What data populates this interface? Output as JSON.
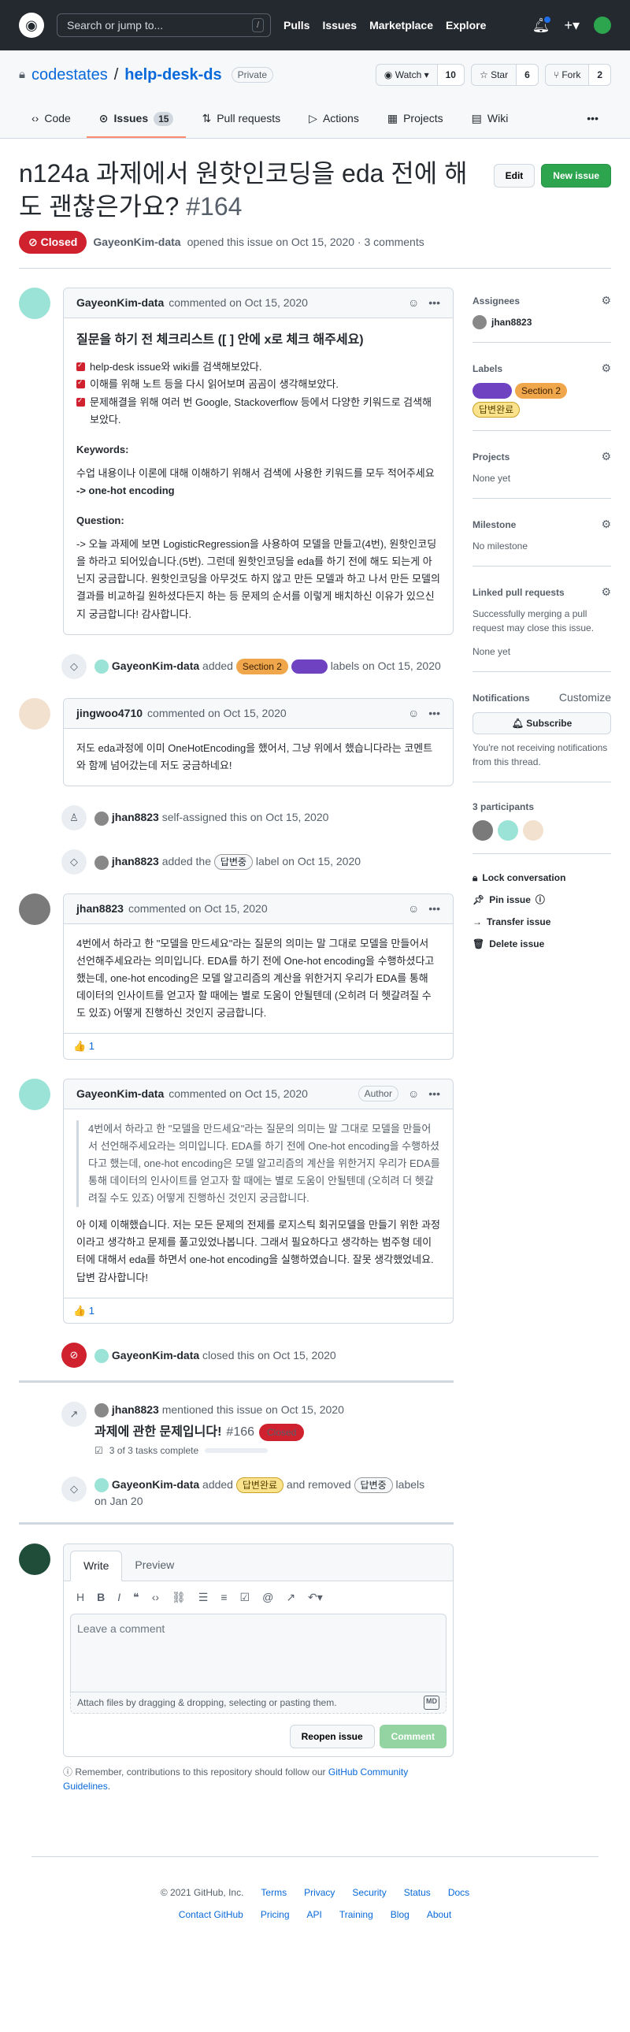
{
  "header": {
    "search_placeholder": "Search or jump to...",
    "search_key": "/",
    "nav": [
      "Pulls",
      "Issues",
      "Marketplace",
      "Explore"
    ]
  },
  "repo": {
    "owner": "codestates",
    "sep": "/",
    "name": "help-desk-ds",
    "visibility": "Private",
    "watch": {
      "label": "Watch",
      "count": "10"
    },
    "star": {
      "label": "Star",
      "count": "6"
    },
    "fork": {
      "label": "Fork",
      "count": "2"
    },
    "tabs": [
      {
        "label": "Code"
      },
      {
        "label": "Issues",
        "count": "15"
      },
      {
        "label": "Pull requests"
      },
      {
        "label": "Actions"
      },
      {
        "label": "Projects"
      },
      {
        "label": "Wiki"
      }
    ]
  },
  "issue": {
    "title": "n124a 과제에서 원핫인코딩을 eda 전에 해도 괜찮은가요?",
    "number": "#164",
    "edit": "Edit",
    "new_issue": "New issue",
    "state": "Closed",
    "author": "GayeonKim-data",
    "meta_text": "opened this issue on Oct 15, 2020 · 3 comments"
  },
  "comments": {
    "c1": {
      "author": "GayeonKim-data",
      "meta": "commented on Oct 15, 2020",
      "heading": "질문을 하기 전 체크리스트 ([ ] 안에 x로 체크 해주세요)",
      "checks": [
        "help-desk issue와 wiki를 검색해보았다.",
        "이해를 위해 노트 등을 다시 읽어보며 곰곰이 생각해보았다.",
        "문제해결을 위해 여러 번 Google, Stackoverflow 등에서 다양한 키워드로 검색해 보았다."
      ],
      "kw_title": "Keywords:",
      "kw_text": "수업 내용이나 이론에 대해 이해하기 위해서 검색에 사용한 키워드를 모두 적어주세요",
      "kw_value": "-> one-hot encoding",
      "q_title": "Question:",
      "q_text": "-> 오늘 과제에 보면 LogisticRegression을 사용하여 모델을 만들고(4번), 원핫인코딩을 하라고 되어있습니다.(5번). 그런데 원핫인코딩을 eda를 하기 전에 해도 되는게 아닌지 궁금합니다. 원핫인코딩을 아무것도 하지 않고 만든 모델과 하고 나서 만든 모델의 결과를 비교하길 원하셨다든지 하는 등 문제의 순서를 이렇게 배치하신 이유가 있으신지 궁금합니다! 감사합니다."
    },
    "ev1": {
      "user": "GayeonKim-data",
      "added": "added",
      "l1": "Section 2",
      "l2": "",
      "tail": "labels on Oct 15, 2020"
    },
    "c2": {
      "author": "jingwoo4710",
      "meta": "commented on Oct 15, 2020",
      "body": "저도 eda과정에 이미 OneHotEncoding을 했어서, 그냥 위에서 했습니다라는 코멘트와 함께 넘어갔는데 저도 궁금하네요!"
    },
    "ev2": {
      "user": "jhan8823",
      "text": "self-assigned this on Oct 15, 2020"
    },
    "ev3": {
      "user": "jhan8823",
      "pre": "added the",
      "label": "답변중",
      "post": "label on Oct 15, 2020"
    },
    "c3": {
      "author": "jhan8823",
      "meta": "commented on Oct 15, 2020",
      "body": "4번에서 하라고 한 \"모델을 만드세요\"라는 질문의 의미는 말 그대로 모델을 만들어서 선언해주세요라는 의미입니다. EDA를 하기 전에 One-hot encoding을 수행하셨다고 했는데, one-hot encoding은 모델 알고리즘의 계산을 위한거지 우리가 EDA를 통해 데이터의 인사이트를 얻고자 할 때에는 별로 도움이 안될텐데 (오히려 더 헷갈려질 수도 있죠) 어떻게 진행하신 것인지 궁금합니다.",
      "reaction": "👍 1"
    },
    "c4": {
      "author": "GayeonKim-data",
      "meta": "commented on Oct 15, 2020",
      "badge": "Author",
      "quote": "4번에서 하라고 한 \"모델을 만드세요\"라는 질문의 의미는 말 그대로 모델을 만들어서 선언해주세요라는 의미입니다. EDA를 하기 전에 One-hot encoding을 수행하셨다고 했는데, one-hot encoding은 모델 알고리즘의 계산을 위한거지 우리가 EDA를 통해 데이터의 인사이트를 얻고자 할 때에는 별로 도움이 안될텐데 (오히려 더 헷갈려질 수도 있죠) 어떻게 진행하신 것인지 궁금합니다.",
      "body": "아 이제 이해했습니다. 저는 모든 문제의 전제를 로지스틱 회귀모델을 만들기 위한 과정이라고 생각하고 문제를 풀고있었나봅니다. 그래서 필요하다고 생각하는 범주형 데이터에 대해서 eda를 하면서 one-hot encoding을 실행하였습니다. 잘못 생각했었네요. 답변 감사합니다!",
      "reaction": "👍 1"
    },
    "ev4": {
      "user": "GayeonKim-data",
      "text": "closed this on Oct 15, 2020"
    },
    "ev5": {
      "user": "jhan8823",
      "text": "mentioned this issue on Oct 15, 2020",
      "ref_title": "과제에 관한 문제입니다!",
      "ref_num": "#166",
      "ref_state": "Closed",
      "ref_tasks": "3 of 3 tasks complete"
    },
    "ev6": {
      "user": "GayeonKim-data",
      "added": "added",
      "l1": "답변완료",
      "mid": "and removed",
      "l2": "답변중",
      "tail": "labels",
      "date": "on Jan 20"
    }
  },
  "editor": {
    "tab_write": "Write",
    "tab_preview": "Preview",
    "placeholder": "Leave a comment",
    "attach": "Attach files by dragging & dropping, selecting or pasting them.",
    "md": "MD",
    "reopen": "Reopen issue",
    "comment": "Comment",
    "note": "Remember, contributions to this repository should follow our",
    "note_link": "GitHub Community Guidelines",
    "note_end": "."
  },
  "sidebar": {
    "assignees": "Assignees",
    "assignee": "jhan8823",
    "labels": "Labels",
    "label_list": [
      "",
      "Section 2",
      "답변완료"
    ],
    "projects": "Projects",
    "projects_val": "None yet",
    "milestone": "Milestone",
    "milestone_val": "No milestone",
    "linked": "Linked pull requests",
    "linked_desc": "Successfully merging a pull request may close this issue.",
    "linked_val": "None yet",
    "notifications": "Notifications",
    "customize": "Customize",
    "subscribe": "Subscribe",
    "notif_text": "You're not receiving notifications from this thread.",
    "participants": "3 participants",
    "lock": "Lock conversation",
    "pin": "Pin issue",
    "transfer": "Transfer issue",
    "delete": "Delete issue"
  },
  "footer": {
    "copyright": "© 2021 GitHub, Inc.",
    "row1": [
      "Terms",
      "Privacy",
      "Security",
      "Status",
      "Docs"
    ],
    "row2": [
      "Contact GitHub",
      "Pricing",
      "API",
      "Training",
      "Blog",
      "About"
    ]
  },
  "colors": {
    "closed": "#cf222e",
    "accent": "#0969da",
    "green": "#2da44e",
    "section2": "#f0a64a",
    "purple": "#6f42c1"
  }
}
